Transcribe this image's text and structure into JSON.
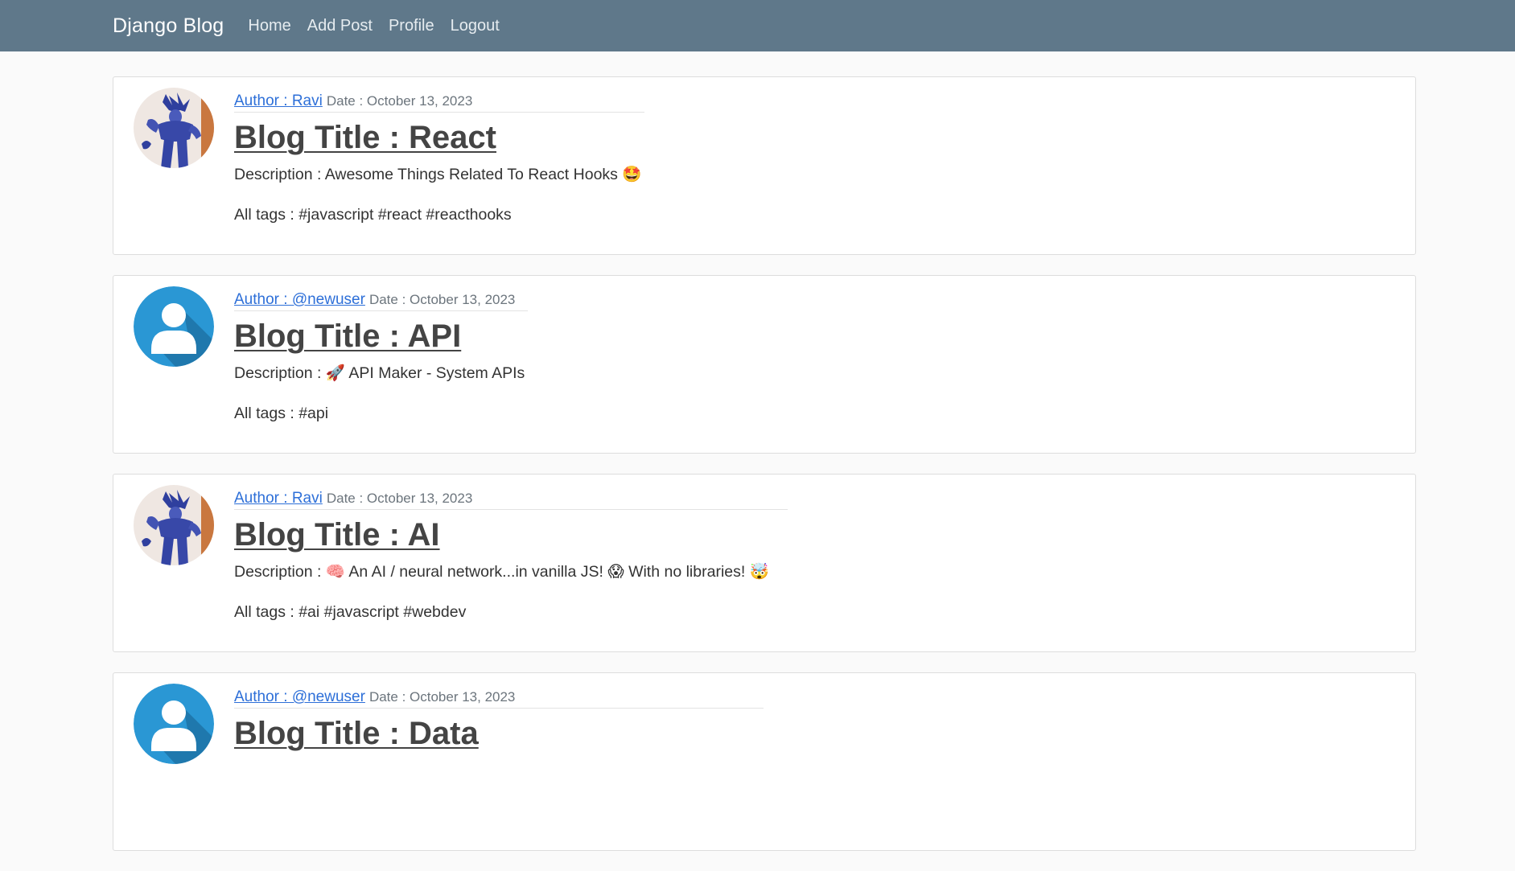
{
  "nav": {
    "brand": "Django Blog",
    "links": [
      "Home",
      "Add Post",
      "Profile",
      "Logout"
    ]
  },
  "colors": {
    "navbar": "#5f788a",
    "link": "#2d6fd8",
    "default_avatar": "#2a97d4"
  },
  "posts": [
    {
      "author": "Author : Ravi",
      "date": "Date : October 13, 2023",
      "title": "Blog Title : React",
      "description": "Description : Awesome Things Related To React Hooks 🤩",
      "tags": "All tags : #javascript #react #reacthooks",
      "avatar": "sketch-avatar-icon"
    },
    {
      "author": "Author : @newuser",
      "date": "Date : October 13, 2023",
      "title": "Blog Title : API",
      "description": "Description : 🚀 API Maker - System APIs",
      "tags": "All tags : #api",
      "avatar": "default-user-icon"
    },
    {
      "author": "Author : Ravi",
      "date": "Date : October 13, 2023",
      "title": "Blog Title : AI",
      "description": "Description : 🧠 An AI / neural network...in vanilla JS! 😱 With no libraries! 🤯",
      "tags": "All tags : #ai #javascript #webdev",
      "avatar": "sketch-avatar-icon"
    },
    {
      "author": "Author : @newuser",
      "date": "Date : October 13, 2023",
      "title": "Blog Title : Data",
      "description": "",
      "tags": "",
      "avatar": "default-user-icon"
    }
  ]
}
